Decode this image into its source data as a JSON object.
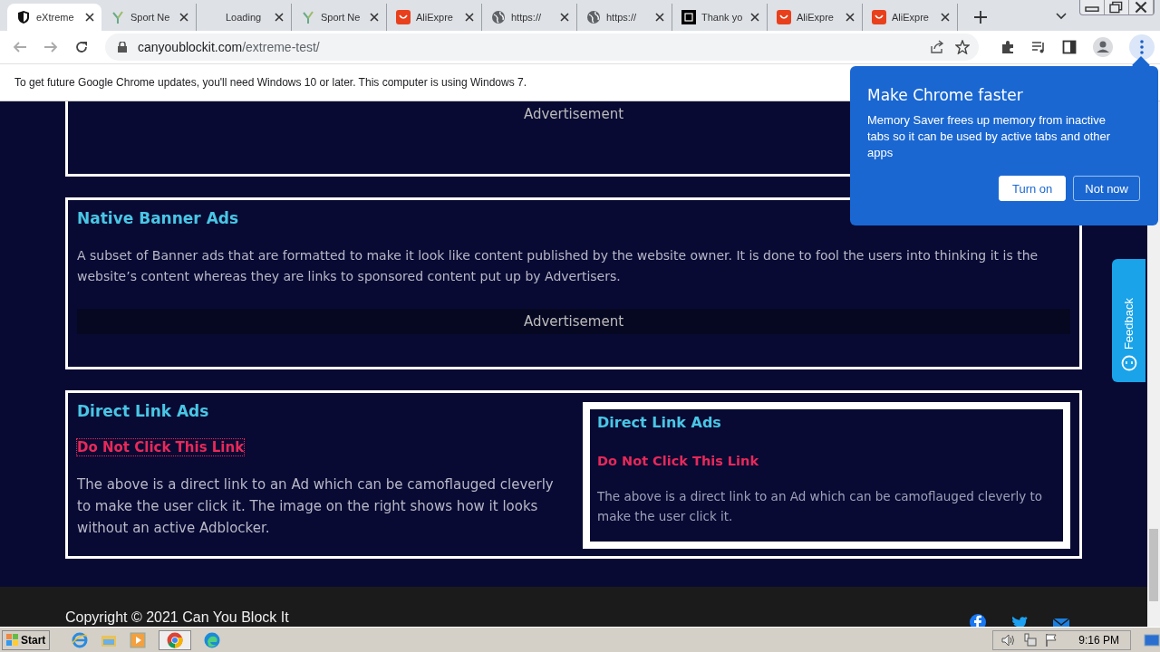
{
  "tabs": [
    {
      "title": "eXtreme",
      "selected": true
    },
    {
      "title": "Sport Ne",
      "selected": false
    },
    {
      "title": "Loading",
      "selected": false
    },
    {
      "title": "Sport Ne",
      "selected": false
    },
    {
      "title": "AliExpre",
      "selected": false
    },
    {
      "title": "https://",
      "selected": false
    },
    {
      "title": "https://",
      "selected": false
    },
    {
      "title": "Thank yo",
      "selected": false
    },
    {
      "title": "AliExpre",
      "selected": false
    },
    {
      "title": "AliExpre",
      "selected": false
    }
  ],
  "address": {
    "host": "canyoublockit.com",
    "path": "/extreme-test/"
  },
  "info_bar": {
    "text": "To get future Google Chrome updates, you'll need Windows 10 or later. This computer is using Windows 7."
  },
  "sections": [
    {
      "kind": "ad",
      "ad_label": "Advertisement"
    },
    {
      "kind": "text_ad",
      "heading": "Native Banner Ads",
      "body": "A subset of Banner ads that are formatted to make it look like content published by the website owner. It is done to fool the users into thinking it is the website’s content whereas they are links to sponsored content put up by Advertisers.",
      "ad_label": "Advertisement"
    },
    {
      "kind": "link",
      "heading": "Direct Link Ads",
      "link": "Do Not Click This Link",
      "body": "The above is a direct link to an Ad which can be camoflauged cleverly to make the user click it. The image on the right shows how it looks without an active Adblocker.",
      "preview": {
        "heading": "Direct Link Ads",
        "link": "Do Not Click This Link",
        "body": "The above is a direct link to an Ad which can be camoflauged cleverly to make the user click it."
      }
    }
  ],
  "popup": {
    "title": "Make Chrome faster",
    "body": "Memory Saver frees up memory from inactive tabs so it can be used by active tabs and other apps",
    "buttons": [
      {
        "label": "Turn on",
        "primary": true
      },
      {
        "label": "Not now",
        "primary": false
      }
    ]
  },
  "feedback": {
    "label": "Feedback"
  },
  "footer": {
    "copyright": "Copyright © 2021 Can You Block It"
  },
  "taskbar": {
    "start": "Start",
    "time": "9:16 PM"
  }
}
